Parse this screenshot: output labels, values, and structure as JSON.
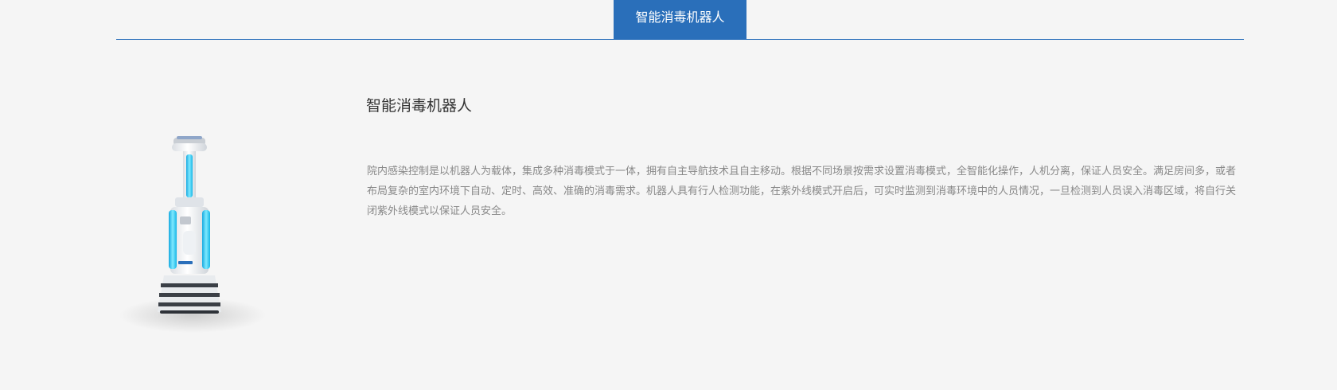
{
  "tabs": {
    "active_label": "智能消毒机器人"
  },
  "product": {
    "title": "智能消毒机器人",
    "description": "院内感染控制是以机器人为载体，集成多种消毒模式于一体，拥有自主导航技术且自主移动。根据不同场景按需求设置消毒模式，全智能化操作，人机分离，保证人员安全。满足房间多，或者布局复杂的室内环境下自动、定时、高效、准确的消毒需求。机器人具有行人检测功能，在紫外线模式开启后，可实时监测到消毒环境中的人员情况，一旦检测到人员误入消毒区域，将自行关闭紫外线模式以保证人员安全。",
    "image_alt": "disinfection-robot"
  },
  "colors": {
    "accent": "#2a6fba",
    "background": "#f5f5f5",
    "title_text": "#333333",
    "body_text": "#888888",
    "uv_light": "#2ad4f0"
  }
}
